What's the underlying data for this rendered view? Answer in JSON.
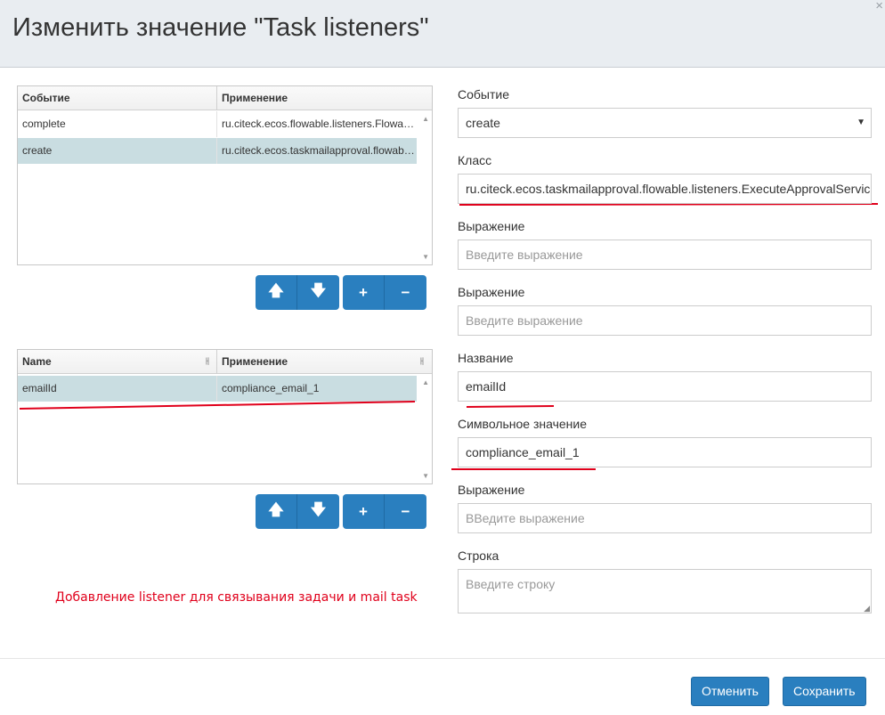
{
  "dialog": {
    "title": "Изменить значение \"Task listeners\"",
    "close": "×"
  },
  "listeners_table": {
    "columns": [
      "Событие",
      "Применение"
    ],
    "rows": [
      [
        "complete",
        "ru.citeck.ecos.flowable.listeners.FlowableAssigneeMod..."
      ],
      [
        "create",
        "ru.citeck.ecos.taskmailapproval.flowable.listeners.ExecuteApprovalServiceTaskListener"
      ]
    ],
    "selected_row": 1
  },
  "fields_table": {
    "columns": [
      "Name",
      "Применение"
    ],
    "rows": [
      [
        "emailId",
        "compliance_email_1"
      ]
    ],
    "selected_row": 0
  },
  "toolbar": {
    "up_icon": "arrow-up-icon",
    "down_icon": "arrow-down-icon",
    "add_icon": "plus-icon",
    "remove_icon": "minus-icon"
  },
  "form": {
    "event_label": "Событие",
    "event_value": "create",
    "class_label": "Класс",
    "class_value": "ru.citeck.ecos.taskmailapproval.flowable.listeners.ExecuteApprovalServiceTaskListener",
    "expression_label_1": "Выражение",
    "expression_placeholder_1": "Введите выражение",
    "expression_label_2": "Выражение",
    "expression_placeholder_2": "Введите выражение",
    "name_label": "Название",
    "name_value": "emailId",
    "string_value_label": "Символьное значение",
    "string_value": "compliance_email_1",
    "expression_label_3": "Выражение",
    "expression_placeholder_3": "ВВедите выражение",
    "string_label": "Строка",
    "string_placeholder": "Введите строку"
  },
  "annotation": {
    "text": "Добавление listener для связывания задачи и mail task",
    "color": "#e0001b"
  },
  "footer": {
    "cancel_label": "Отменить",
    "save_label": "Сохранить"
  },
  "colors": {
    "accent": "#2a7fbf",
    "selected_row": "#c9dde1",
    "header_bg": "#e9edf1"
  }
}
